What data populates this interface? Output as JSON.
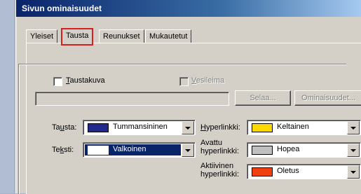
{
  "window": {
    "title": "Sivun ominaisuudet"
  },
  "tabs": [
    {
      "label": "Yleiset"
    },
    {
      "label": "Tausta",
      "active": true
    },
    {
      "label": "Reunukset"
    },
    {
      "label": "Mukautetut"
    }
  ],
  "background": {
    "image_checkbox": {
      "label": "Taustakuva",
      "checked": false
    },
    "watermark_checkbox": {
      "label": "Vesileima",
      "checked": false,
      "disabled": true
    },
    "image_path": {
      "value": ""
    },
    "browse_button": {
      "label": "Selaa..."
    },
    "properties_button": {
      "label": "Ominaisuudet..."
    }
  },
  "colors": {
    "background": {
      "label": "Tausta:",
      "value": "Tummansininen",
      "swatch": "#1f2a8c"
    },
    "text": {
      "label": "Teksti:",
      "value": "Valkoinen",
      "swatch": "#ffffff"
    },
    "hyperlink": {
      "label": "Hyperlinkki:",
      "value": "Keltainen",
      "swatch": "#ffd800"
    },
    "visited": {
      "label_line1": "Avattu",
      "label_line2": "hyperlinkki:",
      "value": "Hopea",
      "swatch": "#c0c0c0"
    },
    "active": {
      "label_line1": "Aktiivinen",
      "label_line2": "hyperlinkki:",
      "value": "Oletus",
      "swatch": "#f04010"
    }
  }
}
